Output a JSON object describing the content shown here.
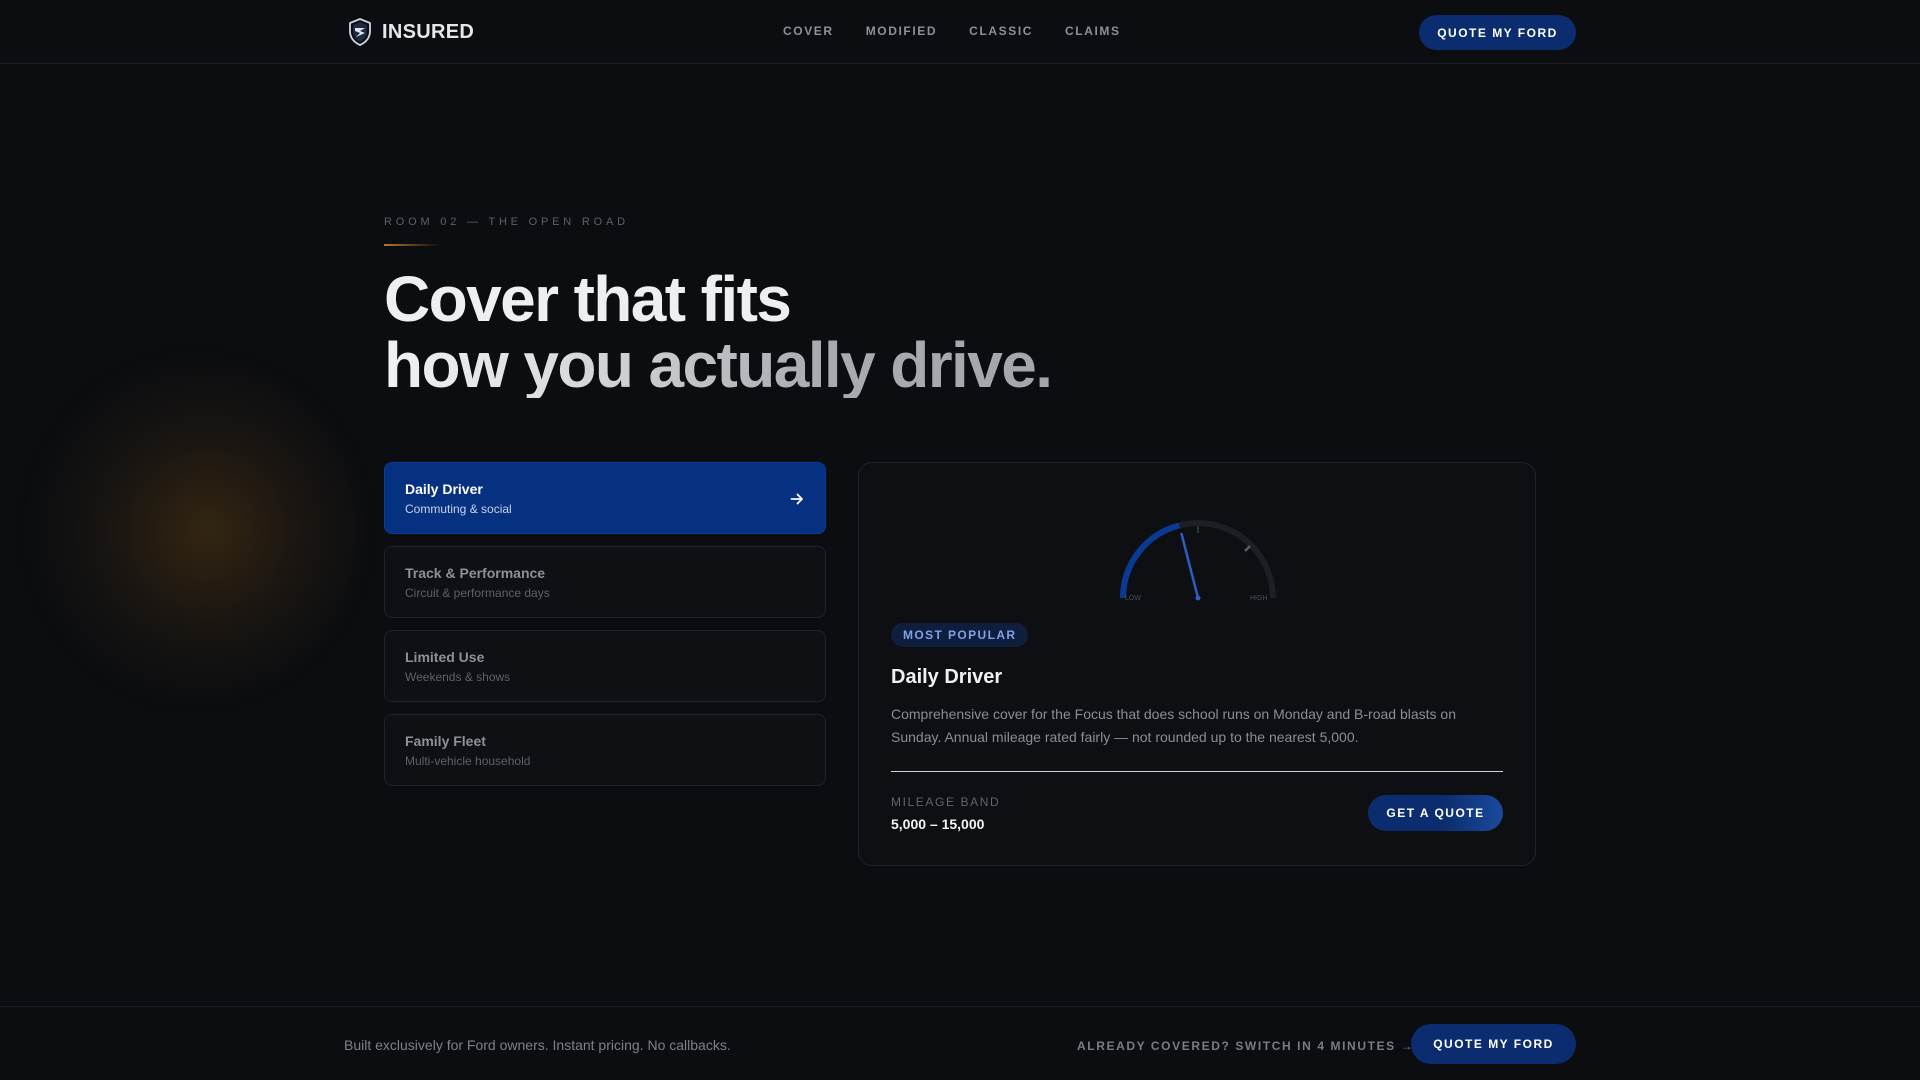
{
  "brand": {
    "name": "INSURED",
    "logo_icon": "shield-icon"
  },
  "nav": {
    "links": [
      "COVER",
      "MODIFIED",
      "CLASSIC",
      "CLAIMS"
    ],
    "cta_label": "QUOTE MY FORD"
  },
  "hero": {
    "eyebrow": "ROOM 02 — THE OPEN ROAD",
    "headline_line1": "Cover that fits",
    "headline_line2": "how you actually drive."
  },
  "options": [
    {
      "title": "Daily Driver",
      "subtitle": "Commuting & social",
      "selected": true,
      "icon": "arrow-right-icon"
    },
    {
      "title": "Track & Performance",
      "subtitle": "Circuit & performance days",
      "selected": false
    },
    {
      "title": "Limited Use",
      "subtitle": "Weekends & shows",
      "selected": false
    },
    {
      "title": "Family Fleet",
      "subtitle": "Multi-vehicle household",
      "selected": false
    }
  ],
  "detail": {
    "gauge": {
      "label_left": "LOW",
      "label_right": "HIGH",
      "level": 0.42
    },
    "badge": "MOST POPULAR",
    "title": "Daily Driver",
    "description": "Comprehensive cover for the Focus that does school runs on Monday and B-road blasts on Sunday. Annual mileage rated fairly — not rounded up to the nearest 5,000.",
    "band_label": "MILEAGE BAND",
    "band_value": "5,000 – 15,000",
    "cta_label": "GET A QUOTE"
  },
  "footer": {
    "note": "Built exclusively for Ford owners. Instant pricing. No callbacks.",
    "link_label": "ALREADY COVERED? SWITCH IN 4 MINUTES →",
    "cta_label": "QUOTE MY FORD"
  },
  "colors": {
    "background": "#0b0d11",
    "accent_blue": "#063080",
    "accent_amber": "#b8762e"
  }
}
